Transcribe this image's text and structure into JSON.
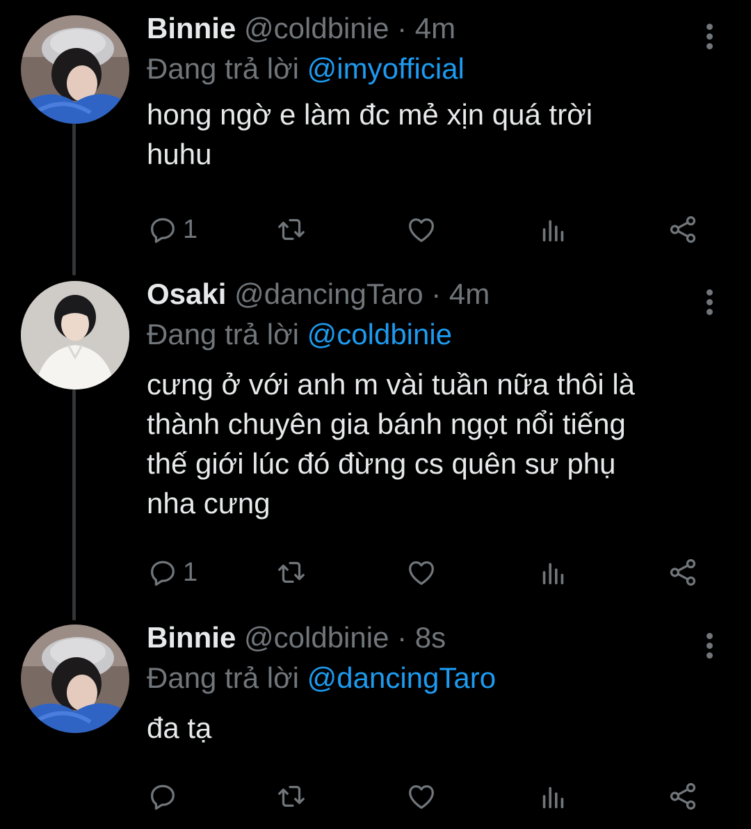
{
  "colors": {
    "background": "#000000",
    "text_primary": "#e7e9ea",
    "text_secondary": "#71767b",
    "mention": "#1d9bf0",
    "thread_line": "#333639"
  },
  "tweets": [
    {
      "name": "Binnie",
      "handle": "@coldbinie",
      "separator": "·",
      "time": "4m",
      "replying_prefix": "Đang trả lời",
      "replying_to": "@imyofficial",
      "lines": [
        "hong ngờ e làm đc mẻ xịn quá trời",
        "huhu"
      ],
      "reply_count": "1",
      "retweet_count": "",
      "like_count": "",
      "avatar": "avatar-binnie"
    },
    {
      "name": "Osaki",
      "handle": "@dancingTaro",
      "separator": "·",
      "time": "4m",
      "replying_prefix": "Đang trả lời",
      "replying_to": "@coldbinie",
      "lines": [
        "cưng ở với anh m vài tuần nữa thôi là",
        "thành chuyên gia bánh ngọt nổi tiếng",
        "thế giới lúc đó đừng cs quên sư phụ",
        "nha cưng"
      ],
      "reply_count": "1",
      "retweet_count": "",
      "like_count": "",
      "avatar": "avatar-osaki"
    },
    {
      "name": "Binnie",
      "handle": "@coldbinie",
      "separator": "·",
      "time": "8s",
      "replying_prefix": "Đang trả lời",
      "replying_to": "@dancingTaro",
      "lines": [
        "đa tạ"
      ],
      "reply_count": "",
      "retweet_count": "",
      "like_count": "",
      "avatar": "avatar-binnie"
    }
  ],
  "icons": {
    "reply": "reply-icon",
    "retweet": "retweet-icon",
    "like": "heart-icon",
    "views": "views-icon",
    "share": "share-icon",
    "more": "more-options-icon"
  }
}
